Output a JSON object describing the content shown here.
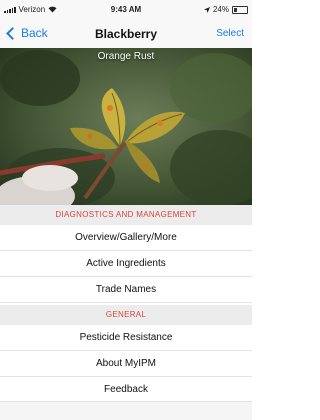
{
  "status": {
    "carrier": "Verizon",
    "time": "9:43 AM",
    "battery": "24%"
  },
  "nav": {
    "back_label": "Back",
    "title": "Blackberry",
    "select_label": "Select"
  },
  "hero": {
    "caption": "Orange Rust"
  },
  "sections": [
    {
      "header": "DIAGNOSTICS AND MANAGEMENT",
      "items": [
        "Overview/Gallery/More",
        "Active Ingredients",
        "Trade Names"
      ]
    },
    {
      "header": "GENERAL",
      "items": [
        "Pesticide Resistance",
        "About MyIPM",
        "Feedback"
      ]
    }
  ],
  "colors": {
    "accent": "#1a7fe0",
    "section_header_text": "#d9443b",
    "section_header_bg": "#ececec"
  }
}
